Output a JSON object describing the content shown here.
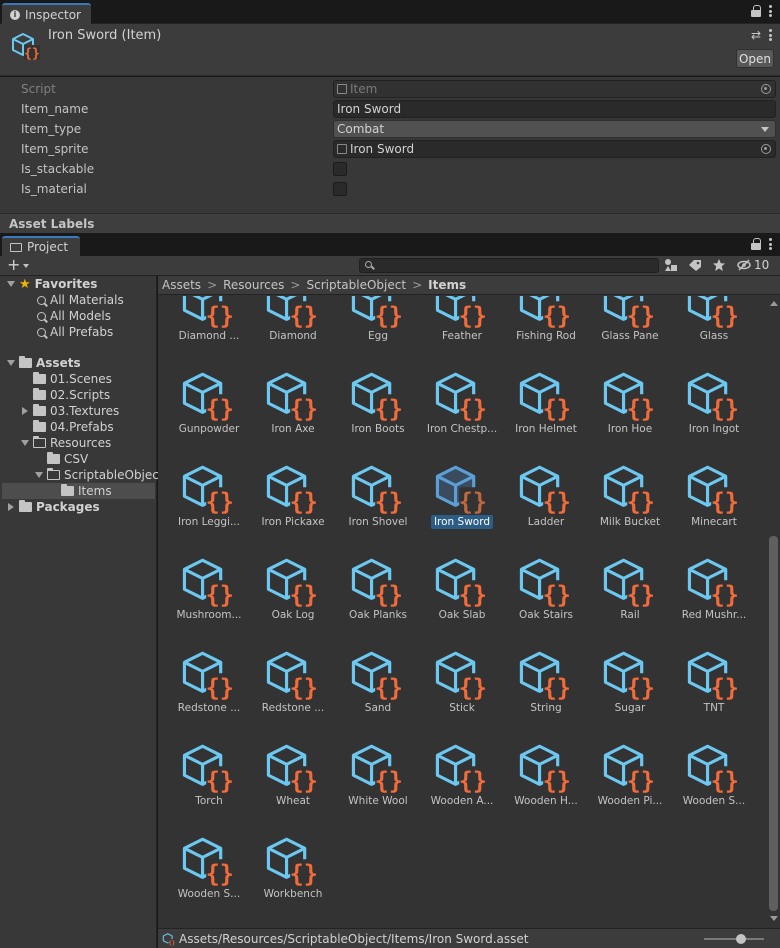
{
  "inspector": {
    "tab_label": "Inspector",
    "title": "Iron Sword (Item)",
    "open_label": "Open",
    "properties": [
      {
        "label": "Script",
        "value": "Item",
        "kind": "script"
      },
      {
        "label": "Item_name",
        "value": "Iron Sword",
        "kind": "text"
      },
      {
        "label": "Item_type",
        "value": "Combat",
        "kind": "dropdown"
      },
      {
        "label": "Item_sprite",
        "value": "Iron Sword",
        "kind": "object"
      },
      {
        "label": "Is_stackable",
        "value": "",
        "kind": "checkbox"
      },
      {
        "label": "Is_material",
        "value": "",
        "kind": "checkbox"
      }
    ],
    "asset_labels": "Asset Labels"
  },
  "project": {
    "tab_label": "Project",
    "hidden_count": "10",
    "tree": [
      {
        "label": "Favorites",
        "level": 0,
        "expand": "down",
        "icon": "star-icon",
        "bold": true
      },
      {
        "label": "All Materials",
        "level": 1,
        "icon": "search-icon"
      },
      {
        "label": "All Models",
        "level": 1,
        "icon": "search-icon"
      },
      {
        "label": "All Prefabs",
        "level": 1,
        "icon": "search-icon"
      },
      {
        "label": "Assets",
        "level": 0,
        "expand": "down",
        "icon": "folder-icon",
        "bold": true
      },
      {
        "label": "01.Scenes",
        "level": 1,
        "icon": "folder-icon"
      },
      {
        "label": "02.Scripts",
        "level": 1,
        "icon": "folder-icon"
      },
      {
        "label": "03.Textures",
        "level": 1,
        "expand": "right",
        "icon": "folder-icon"
      },
      {
        "label": "04.Prefabs",
        "level": 1,
        "icon": "folder-icon"
      },
      {
        "label": "Resources",
        "level": 1,
        "expand": "down",
        "icon": "folder-open-icon"
      },
      {
        "label": "CSV",
        "level": 2,
        "icon": "folder-icon"
      },
      {
        "label": "ScriptableObject",
        "level": 2,
        "expand": "down",
        "icon": "folder-open-icon"
      },
      {
        "label": "Items",
        "level": 3,
        "icon": "folder-icon",
        "selected": true
      },
      {
        "label": "Packages",
        "level": 0,
        "expand": "right",
        "icon": "folder-icon",
        "bold": true
      }
    ],
    "breadcrumb": [
      "Assets",
      "Resources",
      "ScriptableObject",
      "Items"
    ],
    "items": [
      "Diamond ...",
      "Diamond",
      "Egg",
      "Feather",
      "Fishing Rod",
      "Glass Pane",
      "Glass",
      "Gunpowder",
      "Iron Axe",
      "Iron Boots",
      "Iron Chestp...",
      "Iron Helmet",
      "Iron Hoe",
      "Iron Ingot",
      "Iron Leggi...",
      "Iron Pickaxe",
      "Iron Shovel",
      "Iron Sword",
      "Ladder",
      "Milk Bucket",
      "Minecart",
      "Mushroom...",
      "Oak Log",
      "Oak Planks",
      "Oak Slab",
      "Oak Stairs",
      "Rail",
      "Red Mushr...",
      "Redstone ...",
      "Redstone ...",
      "Sand",
      "Stick",
      "String",
      "Sugar",
      "TNT",
      "Torch",
      "Wheat",
      "White Wool",
      "Wooden A...",
      "Wooden H...",
      "Wooden Pi...",
      "Wooden S...",
      "Wooden S...",
      "Workbench"
    ],
    "selected_item": "Iron Sword",
    "status_path": "Assets/Resources/ScriptableObject/Items/Iron Sword.asset"
  },
  "colors": {
    "asset_icon_blue": "#6cc8f0",
    "asset_icon_orange": "#f26b3a",
    "selection": "#2c5d87",
    "tab_accent": "#3a79bb"
  }
}
